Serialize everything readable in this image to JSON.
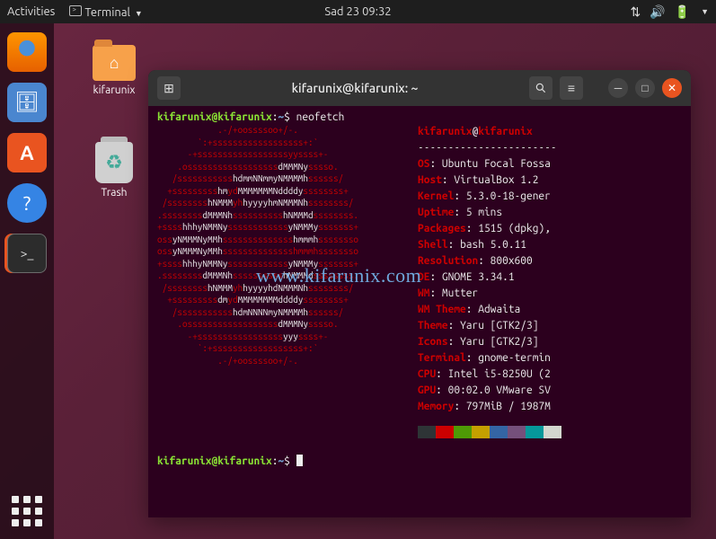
{
  "topbar": {
    "activities": "Activities",
    "terminal": "Terminal",
    "clock": "Sad 23  09:32"
  },
  "desktop": {
    "folder_label": "kifarunix",
    "trash_label": "Trash"
  },
  "dock": {
    "items": [
      {
        "name": "firefox-icon"
      },
      {
        "name": "files-icon"
      },
      {
        "name": "software-icon"
      },
      {
        "name": "help-icon"
      },
      {
        "name": "terminal-icon"
      }
    ]
  },
  "terminal": {
    "title": "kifarunix@kifarunix: ~",
    "prompt_user": "kifarunix@kifarunix",
    "prompt_path": "~",
    "prompt_sep": ":",
    "prompt_char": "$",
    "command": "neofetch",
    "ascii": [
      [
        {
          "c": "r",
          "t": "            .-/+oossssoo+/-."
        }
      ],
      [
        {
          "c": "r",
          "t": "        `:+ssssssssssssssssss+:`"
        }
      ],
      [
        {
          "c": "r",
          "t": "      -+ssssssssssssssssssyyssss+-"
        }
      ],
      [
        {
          "c": "r",
          "t": "    .ossssssssssssssssss"
        },
        {
          "c": "w",
          "t": "dMMMNy"
        },
        {
          "c": "r",
          "t": "sssso."
        }
      ],
      [
        {
          "c": "r",
          "t": "   /sssssssssss"
        },
        {
          "c": "w",
          "t": "hdmmNNmmyNMMMMh"
        },
        {
          "c": "r",
          "t": "ssssss/"
        }
      ],
      [
        {
          "c": "r",
          "t": "  +sssssssss"
        },
        {
          "c": "w",
          "t": "hm"
        },
        {
          "c": "r",
          "t": "yd"
        },
        {
          "c": "w",
          "t": "MMMMMMMNddddy"
        },
        {
          "c": "r",
          "t": "ssssssss+"
        }
      ],
      [
        {
          "c": "r",
          "t": " /ssssssss"
        },
        {
          "c": "w",
          "t": "hNMMM"
        },
        {
          "c": "r",
          "t": "yh"
        },
        {
          "c": "w",
          "t": "hyyyyhmNMMMNh"
        },
        {
          "c": "r",
          "t": "ssssssss/"
        }
      ],
      [
        {
          "c": "r",
          "t": ".ssssssss"
        },
        {
          "c": "w",
          "t": "dMMMNh"
        },
        {
          "c": "r",
          "t": "ssssssssss"
        },
        {
          "c": "w",
          "t": "hNMMMd"
        },
        {
          "c": "r",
          "t": "ssssssss."
        }
      ],
      [
        {
          "c": "r",
          "t": "+ssss"
        },
        {
          "c": "w",
          "t": "hhhyNMMNy"
        },
        {
          "c": "r",
          "t": "ssssssssssss"
        },
        {
          "c": "w",
          "t": "yNMMMy"
        },
        {
          "c": "r",
          "t": "sssssss+"
        }
      ],
      [
        {
          "c": "r",
          "t": "oss"
        },
        {
          "c": "w",
          "t": "yNMMMNyMMh"
        },
        {
          "c": "r",
          "t": "ssssssssssssss"
        },
        {
          "c": "w",
          "t": "hmmmh"
        },
        {
          "c": "r",
          "t": "ssssssso"
        }
      ],
      [
        {
          "c": "r",
          "t": "oss"
        },
        {
          "c": "w",
          "t": "yNMMMNyMMh"
        },
        {
          "c": "r",
          "t": "sssssssssssssshmmmhssssssso"
        }
      ],
      [
        {
          "c": "r",
          "t": "+ssss"
        },
        {
          "c": "w",
          "t": "hhhyNMMNy"
        },
        {
          "c": "r",
          "t": "ssssssssssss"
        },
        {
          "c": "w",
          "t": "yNMMMy"
        },
        {
          "c": "r",
          "t": "sssssss+"
        }
      ],
      [
        {
          "c": "r",
          "t": ".ssssssss"
        },
        {
          "c": "w",
          "t": "dMMMNh"
        },
        {
          "c": "r",
          "t": "ssssssssss"
        },
        {
          "c": "w",
          "t": "hNMMMd"
        },
        {
          "c": "r",
          "t": "ssssssss."
        }
      ],
      [
        {
          "c": "r",
          "t": " /ssssssss"
        },
        {
          "c": "w",
          "t": "hNMMM"
        },
        {
          "c": "r",
          "t": "yh"
        },
        {
          "c": "w",
          "t": "hyyyyhdNMMMNh"
        },
        {
          "c": "r",
          "t": "ssssssss/"
        }
      ],
      [
        {
          "c": "r",
          "t": "  +sssssssss"
        },
        {
          "c": "w",
          "t": "dm"
        },
        {
          "c": "r",
          "t": "yd"
        },
        {
          "c": "w",
          "t": "MMMMMMMMddddy"
        },
        {
          "c": "r",
          "t": "ssssssss+"
        }
      ],
      [
        {
          "c": "r",
          "t": "   /sssssssssss"
        },
        {
          "c": "w",
          "t": "hdmNNNNmyNMMMMh"
        },
        {
          "c": "r",
          "t": "ssssss/"
        }
      ],
      [
        {
          "c": "r",
          "t": "    .ossssssssssssssssss"
        },
        {
          "c": "w",
          "t": "dMMMNy"
        },
        {
          "c": "r",
          "t": "sssso."
        }
      ],
      [
        {
          "c": "r",
          "t": "      -+sssssssssssssssss"
        },
        {
          "c": "w",
          "t": "yyy"
        },
        {
          "c": "r",
          "t": "ssss+-"
        }
      ],
      [
        {
          "c": "r",
          "t": "        `:+ssssssssssssssssss+:`"
        }
      ],
      [
        {
          "c": "r",
          "t": "            .-/+oossssoo+/-."
        }
      ]
    ],
    "info_header_user": "kifarunix",
    "info_header_at": "@",
    "info_header_host": "kifarunix",
    "info_divider": "-----------------------",
    "info": [
      {
        "k": "OS",
        "v": "Ubuntu Focal Fossa"
      },
      {
        "k": "Host",
        "v": "VirtualBox 1.2"
      },
      {
        "k": "Kernel",
        "v": "5.3.0-18-gener"
      },
      {
        "k": "Uptime",
        "v": "5 mins"
      },
      {
        "k": "Packages",
        "v": "1515 (dpkg),"
      },
      {
        "k": "Shell",
        "v": "bash 5.0.11"
      },
      {
        "k": "Resolution",
        "v": "800x600"
      },
      {
        "k": "DE",
        "v": "GNOME 3.34.1"
      },
      {
        "k": "WM",
        "v": "Mutter"
      },
      {
        "k": "WM Theme",
        "v": "Adwaita"
      },
      {
        "k": "Theme",
        "v": "Yaru [GTK2/3]"
      },
      {
        "k": "Icons",
        "v": "Yaru [GTK2/3]"
      },
      {
        "k": "Terminal",
        "v": "gnome-termin"
      },
      {
        "k": "CPU",
        "v": "Intel i5-8250U (2"
      },
      {
        "k": "GPU",
        "v": "00:02.0 VMware SV"
      },
      {
        "k": "Memory",
        "v": "797MiB / 1987M"
      }
    ]
  },
  "watermark": "www.kifarunix.com"
}
